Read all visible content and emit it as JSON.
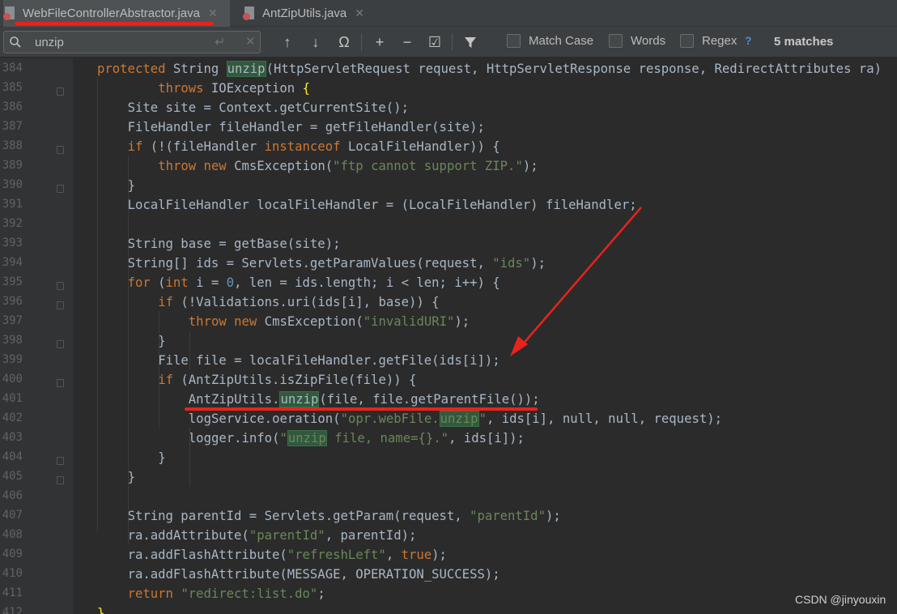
{
  "tabs": [
    {
      "label": "WebFileControllerAbstractor.java",
      "active": true
    },
    {
      "label": "AntZipUtils.java",
      "active": false
    }
  ],
  "find": {
    "query": "unzip",
    "options": [
      "Match Case",
      "Words",
      "Regex"
    ],
    "help": "?",
    "matches": "5 matches"
  },
  "watermark": "CSDN @jinyouxin",
  "colors": {
    "keyword": "#cc7832",
    "string": "#6a8759",
    "number": "#6897bb",
    "match_highlight": "#32593d",
    "annotation_red": "#e8231c"
  },
  "code": {
    "line_numbers": [
      "384",
      "385",
      "386",
      "387",
      "388",
      "389",
      "390",
      "391",
      "392",
      "393",
      "394",
      "395",
      "396",
      "397",
      "398",
      "399",
      "400",
      "401",
      "402",
      "403",
      "404",
      "405",
      "406",
      "407",
      "408",
      "409",
      "410",
      "411",
      "412"
    ],
    "lines": [
      [
        {
          "t": "protected String ",
          "c": "kw1"
        },
        {
          "t": "unzip",
          "c": "hl"
        },
        {
          "t": "(HttpServletRequest request, HttpServletResponse response, RedirectAttributes ra)"
        }
      ],
      [
        {
          "t": "    "
        },
        {
          "t": "throws",
          "c": "kw"
        },
        {
          "t": " IOException "
        },
        {
          "t": "{",
          "c": "brace"
        }
      ],
      [
        {
          "t": "  Site site = Context.getCurrentSite();"
        }
      ],
      [
        {
          "t": "  FileHandler fileHandler = getFileHandler(site);"
        }
      ],
      [
        {
          "t": "  "
        },
        {
          "t": "if",
          "c": "kw"
        },
        {
          "t": " (!(fileHandler "
        },
        {
          "t": "instanceof",
          "c": "kw"
        },
        {
          "t": " LocalFileHandler)) {"
        }
      ],
      [
        {
          "t": "    "
        },
        {
          "t": "throw new",
          "c": "kw"
        },
        {
          "t": " CmsException("
        },
        {
          "t": "\"ftp cannot support ZIP.\"",
          "c": "str"
        },
        {
          "t": ");"
        }
      ],
      [
        {
          "t": "  }"
        }
      ],
      [
        {
          "t": "  LocalFileHandler localFileHandler = (LocalFileHandler) fileHandler;"
        }
      ],
      [
        {
          "t": ""
        }
      ],
      [
        {
          "t": "  String base = getBase(site);"
        }
      ],
      [
        {
          "t": "  String[] ids = Servlets.getParamValues(request, "
        },
        {
          "t": "\"ids\"",
          "c": "str"
        },
        {
          "t": ");"
        }
      ],
      [
        {
          "t": "  "
        },
        {
          "t": "for",
          "c": "kw"
        },
        {
          "t": " ("
        },
        {
          "t": "int",
          "c": "kw"
        },
        {
          "t": " i = "
        },
        {
          "t": "0",
          "c": "num"
        },
        {
          "t": ", len = ids.length; i < len; i++) {"
        }
      ],
      [
        {
          "t": "    "
        },
        {
          "t": "if",
          "c": "kw"
        },
        {
          "t": " (!Validations.uri(ids[i], base)) {"
        }
      ],
      [
        {
          "t": "      "
        },
        {
          "t": "throw new",
          "c": "kw"
        },
        {
          "t": " CmsException("
        },
        {
          "t": "\"invalidURI\"",
          "c": "str"
        },
        {
          "t": ");"
        }
      ],
      [
        {
          "t": "    }"
        }
      ],
      [
        {
          "t": "    File file = localFileHandler.getFile(ids[i]);"
        }
      ],
      [
        {
          "t": "    "
        },
        {
          "t": "if",
          "c": "kw"
        },
        {
          "t": " (AntZipUtils.isZipFile(file)) {"
        }
      ],
      [
        {
          "t": "      AntZipUtils."
        },
        {
          "t": "unzip",
          "c": "hl"
        },
        {
          "t": "(file, file.getParentFile());"
        }
      ],
      [
        {
          "t": "      logService.oeration("
        },
        {
          "t": "\"opr.webFile.",
          "c": "str"
        },
        {
          "t": "unzip",
          "c": "hlstr"
        },
        {
          "t": "\"",
          "c": "str"
        },
        {
          "t": ", ids[i], null, null, request);"
        }
      ],
      [
        {
          "t": "      logger.info("
        },
        {
          "t": "\"",
          "c": "str"
        },
        {
          "t": "unzip",
          "c": "hlstr"
        },
        {
          "t": " file, name={}.\"",
          "c": "str"
        },
        {
          "t": ", ids[i]);"
        }
      ],
      [
        {
          "t": "    }"
        }
      ],
      [
        {
          "t": "  }"
        }
      ],
      [
        {
          "t": ""
        }
      ],
      [
        {
          "t": "  String parentId = Servlets.getParam(request, "
        },
        {
          "t": "\"parentId\"",
          "c": "str"
        },
        {
          "t": ");"
        }
      ],
      [
        {
          "t": "  ra.addAttribute("
        },
        {
          "t": "\"parentId\"",
          "c": "str"
        },
        {
          "t": ", parentId);"
        }
      ],
      [
        {
          "t": "  ra.addFlashAttribute("
        },
        {
          "t": "\"refreshLeft\"",
          "c": "str"
        },
        {
          "t": ", "
        },
        {
          "t": "true",
          "c": "kw"
        },
        {
          "t": ");"
        }
      ],
      [
        {
          "t": "  ra.addFlashAttribute(MESSAGE, OPERATION_SUCCESS);"
        }
      ],
      [
        {
          "t": "  "
        },
        {
          "t": "return",
          "c": "kw"
        },
        {
          "t": " "
        },
        {
          "t": "\"redirect:list.do\"",
          "c": "str"
        },
        {
          "t": ";"
        }
      ],
      [
        {
          "t": "}",
          "c": "brace"
        }
      ]
    ]
  }
}
